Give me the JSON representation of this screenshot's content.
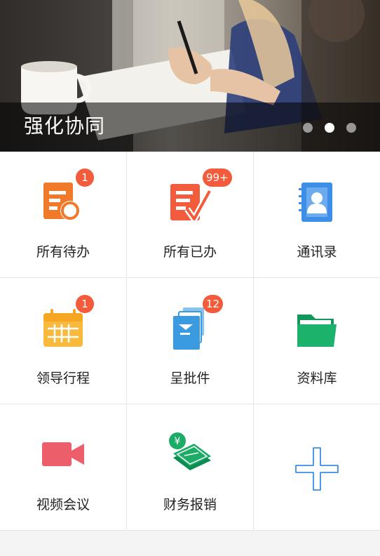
{
  "banner": {
    "caption": "强化协同",
    "slides": 3,
    "active_slide": 2
  },
  "apps": [
    {
      "key": "pending",
      "label": "所有待办",
      "badge": "1",
      "icon": "todo-document-icon",
      "color": "#f07a2a"
    },
    {
      "key": "done",
      "label": "所有已办",
      "badge": "99+",
      "icon": "done-document-check-icon",
      "color": "#f25b3b"
    },
    {
      "key": "contacts",
      "label": "通讯录",
      "badge": "",
      "icon": "address-book-icon",
      "color": "#3d8ee8"
    },
    {
      "key": "schedule",
      "label": "领导行程",
      "badge": "1",
      "icon": "calendar-icon",
      "color": "#f9b93a"
    },
    {
      "key": "submit",
      "label": "呈批件",
      "badge": "12",
      "icon": "documents-stack-icon",
      "color": "#3a9be0"
    },
    {
      "key": "library",
      "label": "资料库",
      "badge": "",
      "icon": "folder-icon",
      "color": "#1db26b"
    },
    {
      "key": "video",
      "label": "视频会议",
      "badge": "",
      "icon": "video-camera-icon",
      "color": "#ec5f6a"
    },
    {
      "key": "finance",
      "label": "财务报销",
      "badge": "",
      "icon": "money-bills-icon",
      "color": "#1dab68"
    },
    {
      "key": "add",
      "label": "",
      "badge": "",
      "icon": "plus-icon",
      "color": "#3d8ee8"
    }
  ]
}
